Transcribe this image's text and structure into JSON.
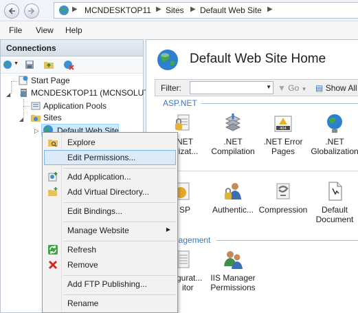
{
  "address": {
    "segments": [
      "MCNDESKTOP11",
      "Sites",
      "Default Web Site"
    ]
  },
  "menu": [
    "File",
    "View",
    "Help"
  ],
  "connections": {
    "header": "Connections",
    "tree": {
      "start_page": "Start Page",
      "server": "MCNDESKTOP11 (MCNSOLUT",
      "app_pools": "Application Pools",
      "sites": "Sites",
      "site": "Default Web Site"
    }
  },
  "main": {
    "title": "Default Web Site Home",
    "filter_label": "Filter:",
    "go_label": "Go",
    "show_all_label": "Show All",
    "section_aspnet": "ASP.NET",
    "section_management": "nagement",
    "features_row1": [
      {
        "icon": "authorization-icon",
        "label1": "NET",
        "label2": "orizat..."
      },
      {
        "icon": "net-compilation-icon",
        "label1": ".NET",
        "label2": "Compilation"
      },
      {
        "icon": "net-error-pages-icon",
        "label1": ".NET Error",
        "label2": "Pages"
      },
      {
        "icon": "net-globalization-icon",
        "label1": ".NET",
        "label2": "Globalization"
      }
    ],
    "features_row2": [
      {
        "icon": "asp-icon",
        "label1": "SP",
        "label2": ""
      },
      {
        "icon": "authentication-icon",
        "label1": "Authentic...",
        "label2": ""
      },
      {
        "icon": "compression-icon",
        "label1": "Compression",
        "label2": ""
      },
      {
        "icon": "default-document-icon",
        "label1": "Default",
        "label2": "Document"
      }
    ],
    "features_row3": [
      {
        "icon": "configuration-editor-icon",
        "label1": "gurat...",
        "label2": "itor"
      },
      {
        "icon": "iis-manager-permissions-icon",
        "label1": "IIS Manager",
        "label2": "Permissions"
      }
    ]
  },
  "context_menu": {
    "items": [
      {
        "label": "Explore",
        "icon": "explore-folder-icon"
      },
      {
        "label": "Edit Permissions...",
        "icon": ""
      },
      {
        "label": "Add Application...",
        "icon": "add-application-icon"
      },
      {
        "label": "Add Virtual Directory...",
        "icon": "add-virtual-directory-icon"
      },
      {
        "label": "Edit Bindings...",
        "icon": ""
      },
      {
        "label": "Manage Website",
        "icon": ""
      },
      {
        "label": "Refresh",
        "icon": "refresh-icon"
      },
      {
        "label": "Remove",
        "icon": "remove-icon"
      },
      {
        "label": "Add FTP Publishing...",
        "icon": ""
      },
      {
        "label": "Rename",
        "icon": ""
      }
    ],
    "highlighted_index": 1
  },
  "colors": {
    "accent": "#3a76c2",
    "highlight": "#dbeaf7",
    "highlight_border": "#7eb4ea"
  }
}
